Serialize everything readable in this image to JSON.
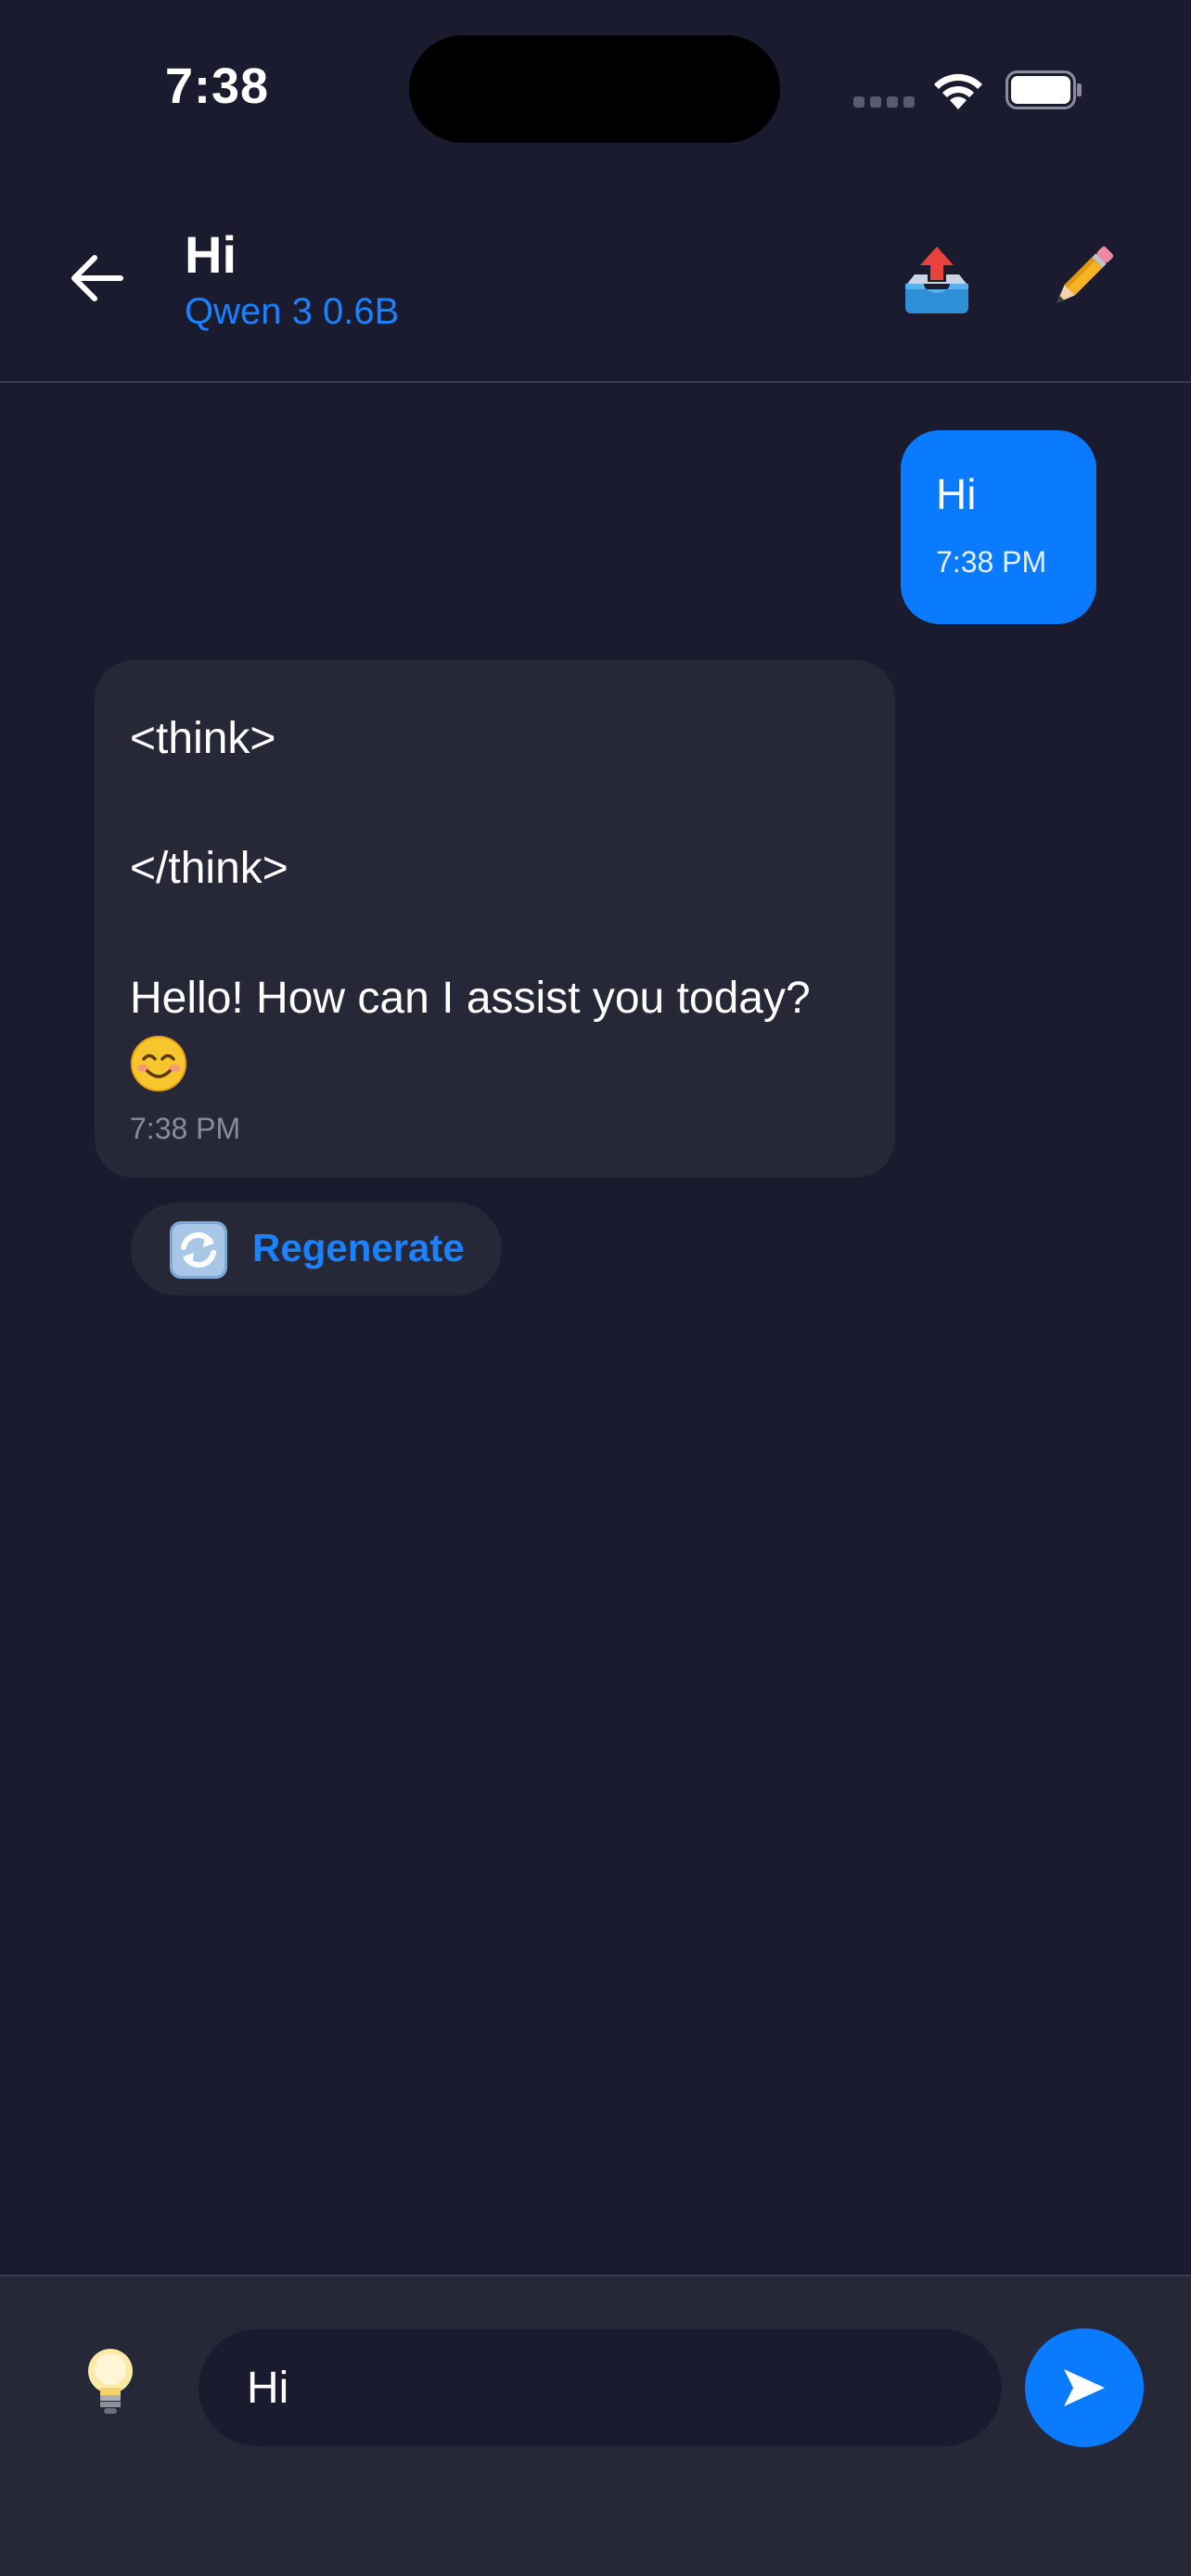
{
  "status_bar": {
    "time": "7:38"
  },
  "header": {
    "title": "Hi",
    "model": "Qwen 3 0.6B",
    "back_icon": "arrow-left-icon",
    "export_icon": "outbox-tray-icon",
    "edit_icon": "pencil-icon"
  },
  "messages": [
    {
      "role": "user",
      "text": "Hi",
      "time": "7:38 PM"
    },
    {
      "role": "assistant",
      "lines": [
        "<think>",
        "</think>",
        "Hello! How can I assist you today?"
      ],
      "emoji": "smiling-face-icon",
      "time": "7:38 PM"
    }
  ],
  "regenerate": {
    "label": "Regenerate",
    "icon": "refresh-icon"
  },
  "composer": {
    "value": "Hi",
    "hint_icon": "light-bulb-icon",
    "send_icon": "send-icon"
  },
  "colors": {
    "background": "#1a1b2e",
    "surface": "#262838",
    "accent": "#0a7aff"
  }
}
